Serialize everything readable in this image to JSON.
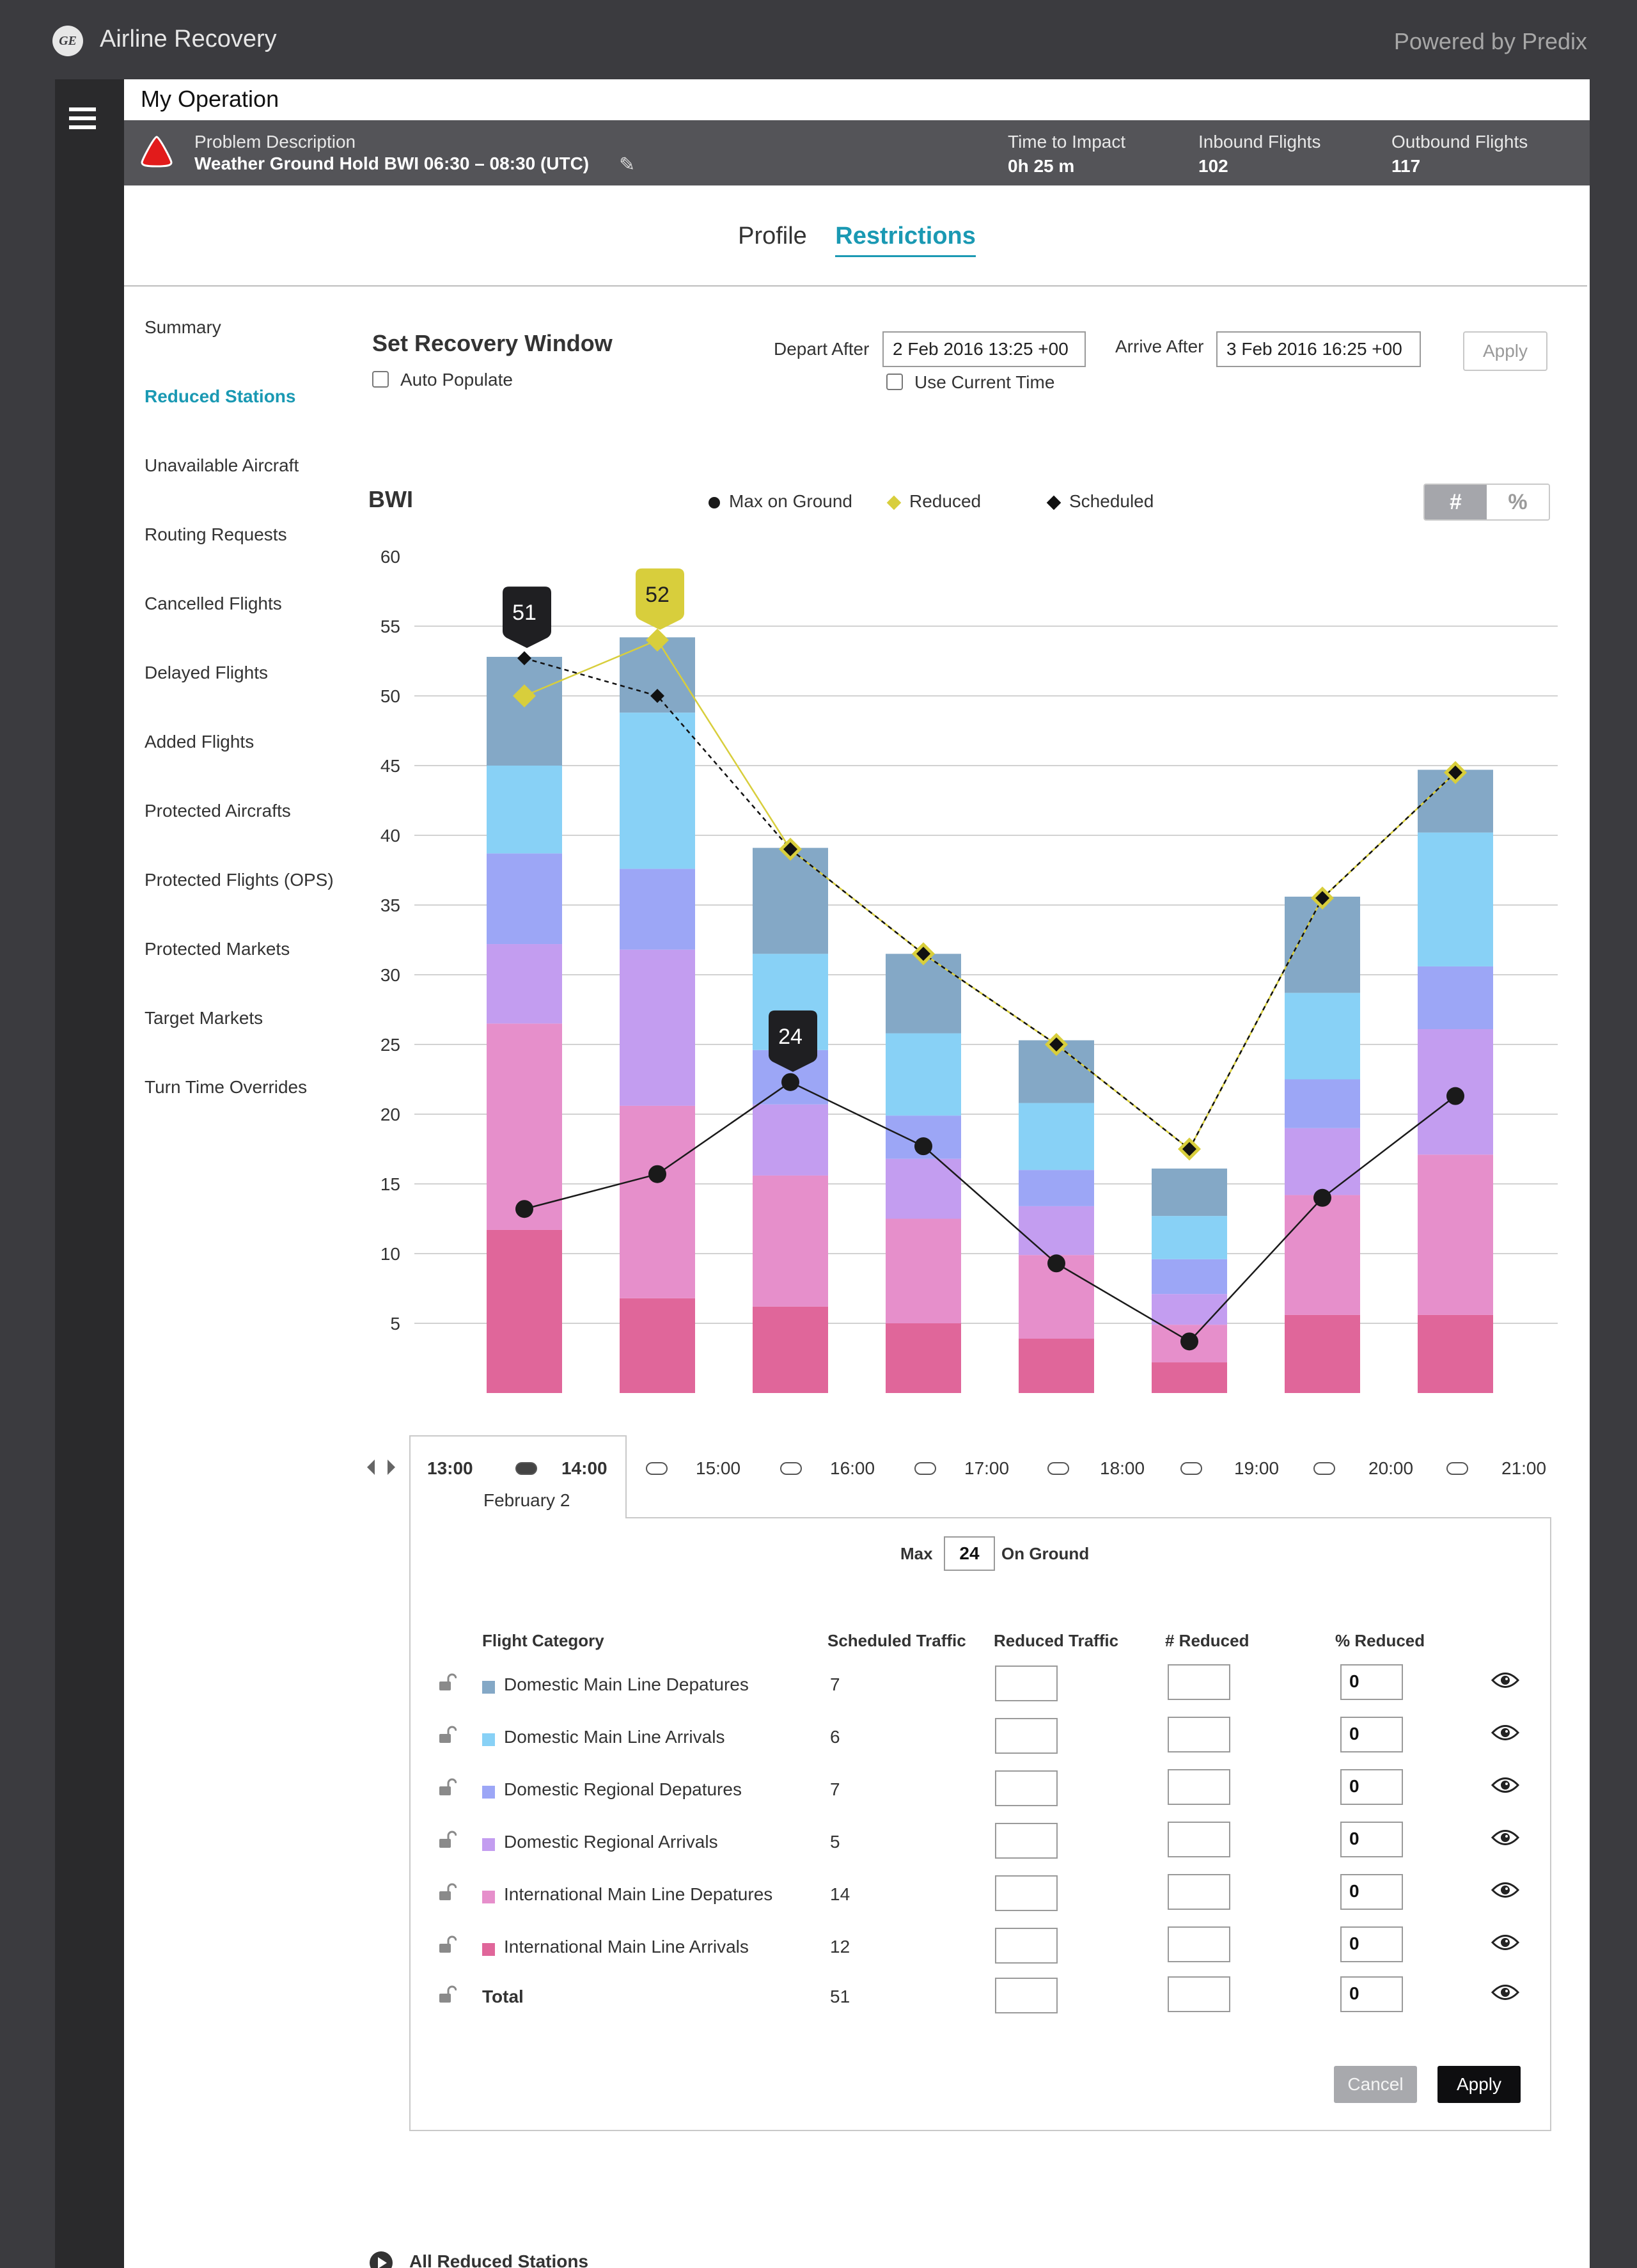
{
  "app": {
    "title": "Airline Recovery",
    "powered_by": "Powered by Predix",
    "logo_text": "GE"
  },
  "page": {
    "title": "My Operation"
  },
  "problem": {
    "label": "Problem Description",
    "value": "Weather Ground Hold BWI 06:30 – 08:30 (UTC)",
    "stats": [
      {
        "label": "Time to Impact",
        "value": "0h 25 m"
      },
      {
        "label": "Inbound Flights",
        "value": "102"
      },
      {
        "label": "Outbound Flights",
        "value": "117"
      }
    ]
  },
  "tabs": [
    {
      "label": "Profile",
      "active": false
    },
    {
      "label": "Restrictions",
      "active": true
    }
  ],
  "sidenav": [
    {
      "label": "Summary",
      "active": false
    },
    {
      "label": "Reduced Stations",
      "active": true
    },
    {
      "label": "Unavailable Aircraft",
      "active": false
    },
    {
      "label": "Routing Requests",
      "active": false
    },
    {
      "label": "Cancelled Flights",
      "active": false
    },
    {
      "label": "Delayed Flights",
      "active": false
    },
    {
      "label": "Added Flights",
      "active": false
    },
    {
      "label": "Protected Aircrafts",
      "active": false
    },
    {
      "label": "Protected Flights (OPS)",
      "active": false
    },
    {
      "label": "Protected Markets",
      "active": false
    },
    {
      "label": "Target Markets",
      "active": false
    },
    {
      "label": "Turn Time Overrides",
      "active": false
    }
  ],
  "recovery": {
    "title": "Set Recovery Window",
    "auto_populate": "Auto Populate",
    "depart_label": "Depart After",
    "depart_value": "2 Feb 2016  13:25 +00",
    "use_current": "Use Current Time",
    "arrive_label": "Arrive After",
    "arrive_value": "3 Feb 2016  16:25 +00",
    "apply": "Apply"
  },
  "chart_header": {
    "station": "BWI",
    "legend": [
      {
        "label": "Max on Ground",
        "marker": "circle",
        "color": "#1a1a1a"
      },
      {
        "label": "Reduced",
        "marker": "diamond",
        "color": "#d8ce3c"
      },
      {
        "label": "Scheduled",
        "marker": "diamond",
        "color": "#111111"
      }
    ],
    "toggle": {
      "count": "#",
      "percent": "%",
      "selected": "count"
    }
  },
  "chart_data": {
    "type": "bar",
    "stacked": true,
    "categories": [
      "13:00",
      "14:00",
      "15:00",
      "16:00",
      "17:00",
      "18:00",
      "19:00",
      "20:00"
    ],
    "ylim": [
      0,
      60
    ],
    "yticks": [
      5,
      10,
      15,
      20,
      25,
      30,
      35,
      40,
      45,
      50,
      55,
      60
    ],
    "grid": true,
    "series": [
      {
        "name": "International Main Line Arrivals",
        "color": "#e0669a",
        "values": [
          11.7,
          6.8,
          6.2,
          5.0,
          3.9,
          2.2,
          5.6,
          5.6
        ]
      },
      {
        "name": "International Main Line Depatures",
        "color": "#e68fcb",
        "values": [
          14.8,
          13.8,
          9.4,
          7.5,
          6.0,
          2.7,
          8.6,
          11.5
        ]
      },
      {
        "name": "Domestic Regional Arrivals",
        "color": "#c39df0",
        "values": [
          5.7,
          11.2,
          5.1,
          4.3,
          3.5,
          2.2,
          4.8,
          9.0
        ]
      },
      {
        "name": "Domestic Regional Depatures",
        "color": "#9ca6f6",
        "values": [
          6.5,
          5.8,
          3.9,
          3.1,
          2.6,
          2.5,
          3.5,
          4.5
        ]
      },
      {
        "name": "Domestic Main Line Arrivals",
        "color": "#88d1f6",
        "values": [
          6.3,
          11.2,
          6.9,
          5.9,
          4.8,
          3.1,
          6.2,
          9.6
        ]
      },
      {
        "name": "Domestic Main Line Depatures",
        "color": "#84a8c6",
        "values": [
          7.8,
          5.4,
          7.6,
          5.7,
          4.5,
          3.4,
          6.9,
          4.5
        ]
      }
    ],
    "lines": [
      {
        "name": "Max on Ground",
        "values": [
          13.2,
          15.7,
          22.3,
          17.7,
          9.3,
          3.7,
          14.0,
          21.3
        ]
      },
      {
        "name": "Reduced",
        "values": [
          50.0,
          54.0,
          39.0,
          31.5,
          25.0,
          17.5,
          35.5,
          44.5
        ]
      },
      {
        "name": "Scheduled",
        "values": [
          52.7,
          50.0,
          39.0,
          31.5,
          25.0,
          17.5,
          35.5,
          44.5
        ]
      }
    ],
    "callouts": [
      {
        "label": "51",
        "category": "13:00",
        "value": 52.7,
        "style": "dark"
      },
      {
        "label": "52",
        "category": "14:00",
        "value": 54.0,
        "style": "yellow"
      },
      {
        "label": "24",
        "category": "15:00",
        "value": 22.3,
        "style": "dark"
      }
    ]
  },
  "timeline": {
    "times": [
      "13:00",
      "14:00",
      "15:00",
      "16:00",
      "17:00",
      "18:00",
      "19:00",
      "20:00",
      "21:00"
    ],
    "date": "February 2"
  },
  "detail": {
    "max_label": "Max",
    "max_value": "24",
    "on_ground": "On Ground",
    "headers": [
      "Flight Category",
      "Scheduled Traffic",
      "Reduced Traffic",
      "# Reduced",
      "% Reduced"
    ],
    "rows": [
      {
        "category": "Domestic Main Line Depatures",
        "color": "#84a8c6",
        "scheduled": "7",
        "reduced": "",
        "num_reduced": "",
        "pct_reduced": "0"
      },
      {
        "category": "Domestic Main Line Arrivals",
        "color": "#88d1f6",
        "scheduled": "6",
        "reduced": "",
        "num_reduced": "",
        "pct_reduced": "0"
      },
      {
        "category": "Domestic Regional Depatures",
        "color": "#9ca6f6",
        "scheduled": "7",
        "reduced": "",
        "num_reduced": "",
        "pct_reduced": "0"
      },
      {
        "category": "Domestic Regional Arrivals",
        "color": "#c39df0",
        "scheduled": "5",
        "reduced": "",
        "num_reduced": "",
        "pct_reduced": "0"
      },
      {
        "category": "International Main Line Depatures",
        "color": "#e68fcb",
        "scheduled": "14",
        "reduced": "",
        "num_reduced": "",
        "pct_reduced": "0"
      },
      {
        "category": "International Main Line Arrivals",
        "color": "#e0669a",
        "scheduled": "12",
        "reduced": "",
        "num_reduced": "",
        "pct_reduced": "0"
      }
    ],
    "total": {
      "category": "Total",
      "scheduled": "51",
      "reduced": "",
      "num_reduced": "",
      "pct_reduced": "0"
    },
    "cancel": "Cancel",
    "apply": "Apply"
  },
  "footer": {
    "all_reduced": "All Reduced Stations"
  }
}
